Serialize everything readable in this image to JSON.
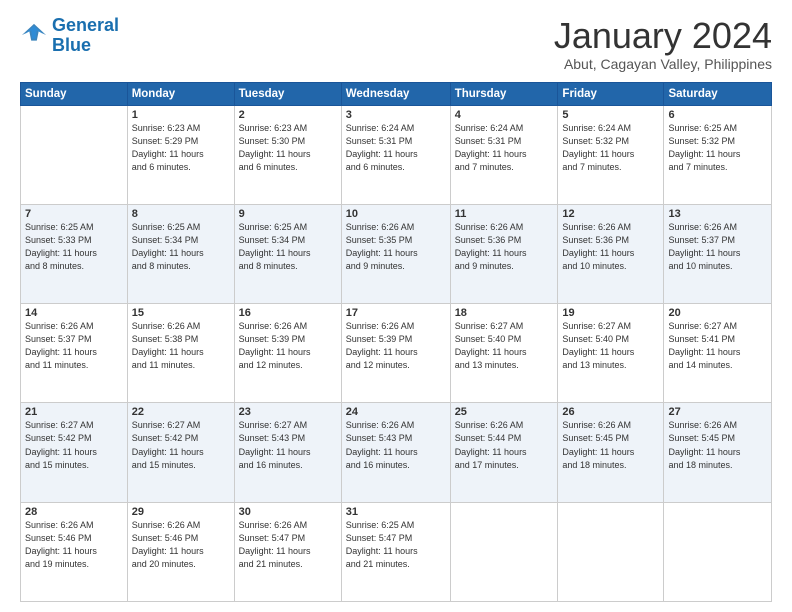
{
  "logo": {
    "line1": "General",
    "line2": "Blue"
  },
  "title": "January 2024",
  "location": "Abut, Cagayan Valley, Philippines",
  "headers": [
    "Sunday",
    "Monday",
    "Tuesday",
    "Wednesday",
    "Thursday",
    "Friday",
    "Saturday"
  ],
  "weeks": [
    [
      {
        "day": "",
        "info": ""
      },
      {
        "day": "1",
        "info": "Sunrise: 6:23 AM\nSunset: 5:29 PM\nDaylight: 11 hours\nand 6 minutes."
      },
      {
        "day": "2",
        "info": "Sunrise: 6:23 AM\nSunset: 5:30 PM\nDaylight: 11 hours\nand 6 minutes."
      },
      {
        "day": "3",
        "info": "Sunrise: 6:24 AM\nSunset: 5:31 PM\nDaylight: 11 hours\nand 6 minutes."
      },
      {
        "day": "4",
        "info": "Sunrise: 6:24 AM\nSunset: 5:31 PM\nDaylight: 11 hours\nand 7 minutes."
      },
      {
        "day": "5",
        "info": "Sunrise: 6:24 AM\nSunset: 5:32 PM\nDaylight: 11 hours\nand 7 minutes."
      },
      {
        "day": "6",
        "info": "Sunrise: 6:25 AM\nSunset: 5:32 PM\nDaylight: 11 hours\nand 7 minutes."
      }
    ],
    [
      {
        "day": "7",
        "info": "Sunrise: 6:25 AM\nSunset: 5:33 PM\nDaylight: 11 hours\nand 8 minutes."
      },
      {
        "day": "8",
        "info": "Sunrise: 6:25 AM\nSunset: 5:34 PM\nDaylight: 11 hours\nand 8 minutes."
      },
      {
        "day": "9",
        "info": "Sunrise: 6:25 AM\nSunset: 5:34 PM\nDaylight: 11 hours\nand 8 minutes."
      },
      {
        "day": "10",
        "info": "Sunrise: 6:26 AM\nSunset: 5:35 PM\nDaylight: 11 hours\nand 9 minutes."
      },
      {
        "day": "11",
        "info": "Sunrise: 6:26 AM\nSunset: 5:36 PM\nDaylight: 11 hours\nand 9 minutes."
      },
      {
        "day": "12",
        "info": "Sunrise: 6:26 AM\nSunset: 5:36 PM\nDaylight: 11 hours\nand 10 minutes."
      },
      {
        "day": "13",
        "info": "Sunrise: 6:26 AM\nSunset: 5:37 PM\nDaylight: 11 hours\nand 10 minutes."
      }
    ],
    [
      {
        "day": "14",
        "info": "Sunrise: 6:26 AM\nSunset: 5:37 PM\nDaylight: 11 hours\nand 11 minutes."
      },
      {
        "day": "15",
        "info": "Sunrise: 6:26 AM\nSunset: 5:38 PM\nDaylight: 11 hours\nand 11 minutes."
      },
      {
        "day": "16",
        "info": "Sunrise: 6:26 AM\nSunset: 5:39 PM\nDaylight: 11 hours\nand 12 minutes."
      },
      {
        "day": "17",
        "info": "Sunrise: 6:26 AM\nSunset: 5:39 PM\nDaylight: 11 hours\nand 12 minutes."
      },
      {
        "day": "18",
        "info": "Sunrise: 6:27 AM\nSunset: 5:40 PM\nDaylight: 11 hours\nand 13 minutes."
      },
      {
        "day": "19",
        "info": "Sunrise: 6:27 AM\nSunset: 5:40 PM\nDaylight: 11 hours\nand 13 minutes."
      },
      {
        "day": "20",
        "info": "Sunrise: 6:27 AM\nSunset: 5:41 PM\nDaylight: 11 hours\nand 14 minutes."
      }
    ],
    [
      {
        "day": "21",
        "info": "Sunrise: 6:27 AM\nSunset: 5:42 PM\nDaylight: 11 hours\nand 15 minutes."
      },
      {
        "day": "22",
        "info": "Sunrise: 6:27 AM\nSunset: 5:42 PM\nDaylight: 11 hours\nand 15 minutes."
      },
      {
        "day": "23",
        "info": "Sunrise: 6:27 AM\nSunset: 5:43 PM\nDaylight: 11 hours\nand 16 minutes."
      },
      {
        "day": "24",
        "info": "Sunrise: 6:26 AM\nSunset: 5:43 PM\nDaylight: 11 hours\nand 16 minutes."
      },
      {
        "day": "25",
        "info": "Sunrise: 6:26 AM\nSunset: 5:44 PM\nDaylight: 11 hours\nand 17 minutes."
      },
      {
        "day": "26",
        "info": "Sunrise: 6:26 AM\nSunset: 5:45 PM\nDaylight: 11 hours\nand 18 minutes."
      },
      {
        "day": "27",
        "info": "Sunrise: 6:26 AM\nSunset: 5:45 PM\nDaylight: 11 hours\nand 18 minutes."
      }
    ],
    [
      {
        "day": "28",
        "info": "Sunrise: 6:26 AM\nSunset: 5:46 PM\nDaylight: 11 hours\nand 19 minutes."
      },
      {
        "day": "29",
        "info": "Sunrise: 6:26 AM\nSunset: 5:46 PM\nDaylight: 11 hours\nand 20 minutes."
      },
      {
        "day": "30",
        "info": "Sunrise: 6:26 AM\nSunset: 5:47 PM\nDaylight: 11 hours\nand 21 minutes."
      },
      {
        "day": "31",
        "info": "Sunrise: 6:25 AM\nSunset: 5:47 PM\nDaylight: 11 hours\nand 21 minutes."
      },
      {
        "day": "",
        "info": ""
      },
      {
        "day": "",
        "info": ""
      },
      {
        "day": "",
        "info": ""
      }
    ]
  ]
}
